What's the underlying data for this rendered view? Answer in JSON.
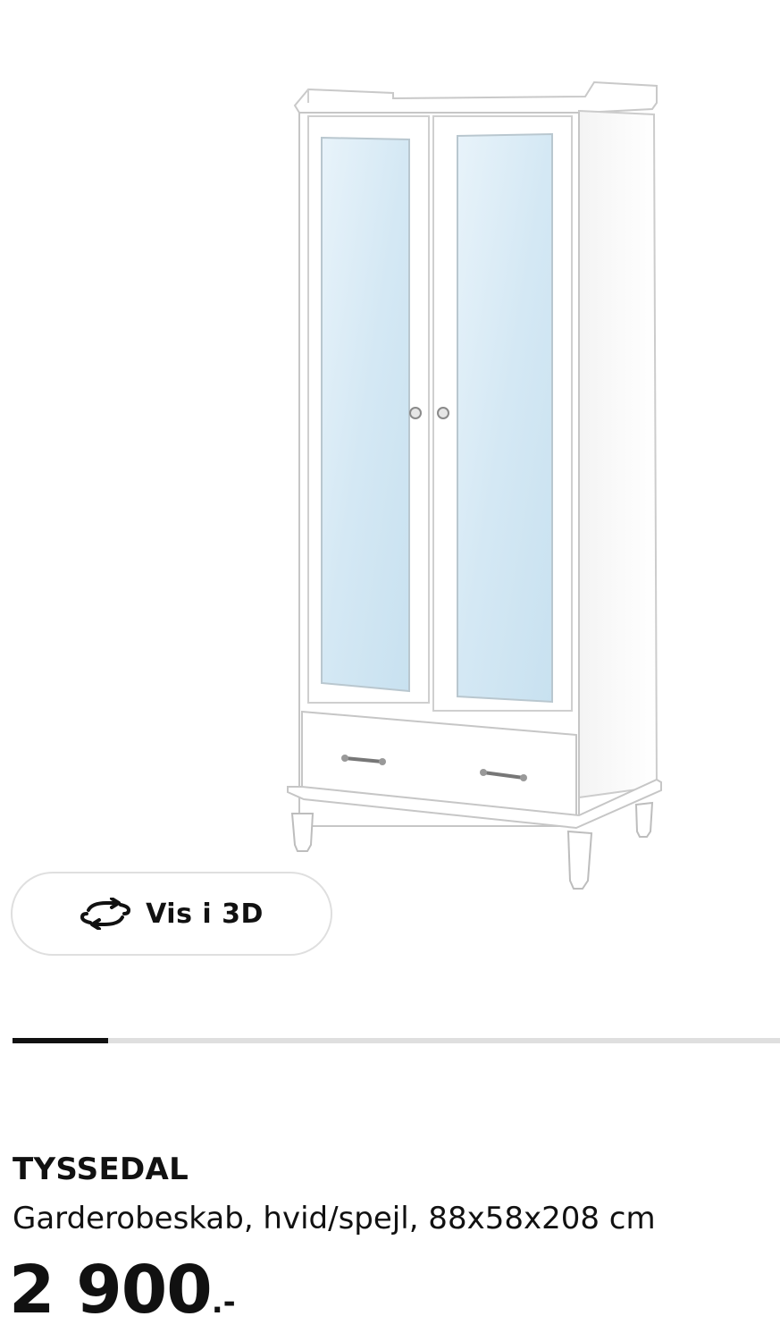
{
  "product_view": {
    "view_3d_label": "Vis i 3D",
    "icon": "rotate-3d-icon"
  },
  "carousel": {
    "progress": 0.125
  },
  "product": {
    "name": "TYSSEDAL",
    "description": "Garderobeskab, hvid/spejl, 88x58x208 cm",
    "price_value": "2 900",
    "price_suffix": ".-"
  },
  "colors": {
    "text": "#111111",
    "track": "#dfdfdf",
    "mirror": "#dcecf6"
  }
}
